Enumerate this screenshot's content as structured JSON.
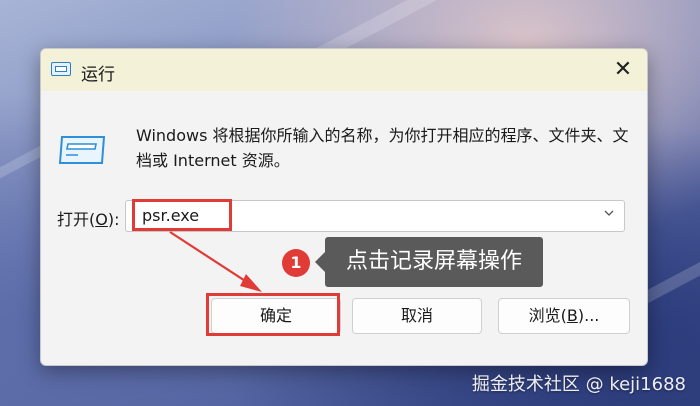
{
  "dialog": {
    "title": "运行",
    "close_glyph": "✕",
    "description": "Windows 将根据你所输入的名称，为你打开相应的程序、文件夹、文档或 Internet 资源。",
    "open_label_prefix": "打开(",
    "open_label_key": "O",
    "open_label_suffix": "):",
    "input_value": "psr.exe",
    "ok_label": "确定",
    "cancel_label": "取消",
    "browse_label_prefix": "浏览(",
    "browse_label_key": "B",
    "browse_label_suffix": ")..."
  },
  "annotation": {
    "step_number": "1",
    "tooltip_text": "点击记录屏幕操作",
    "highlight_color": "#e03b36"
  },
  "watermark": "掘金技术社区 @ keji1688"
}
